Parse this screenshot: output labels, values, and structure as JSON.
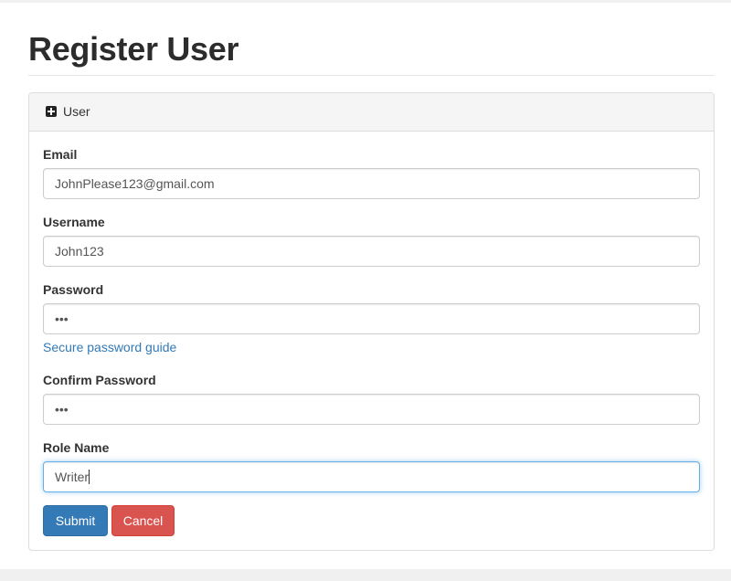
{
  "page": {
    "title": "Register User"
  },
  "panel": {
    "title": "User",
    "icon": "plus-square-icon"
  },
  "form": {
    "email": {
      "label": "Email",
      "value": "JohnPlease123@gmail.com"
    },
    "username": {
      "label": "Username",
      "value": "John123"
    },
    "password": {
      "label": "Password",
      "value": "•••"
    },
    "password_help": "Secure password guide",
    "confirm_password": {
      "label": "Confirm Password",
      "value": "•••"
    },
    "role_name": {
      "label": "Role Name",
      "value": "Writer"
    }
  },
  "buttons": {
    "submit": "Submit",
    "cancel": "Cancel"
  },
  "colors": {
    "primary": "#337ab7",
    "danger": "#d9534f",
    "link": "#337ab7",
    "focus": "#66afe9"
  }
}
